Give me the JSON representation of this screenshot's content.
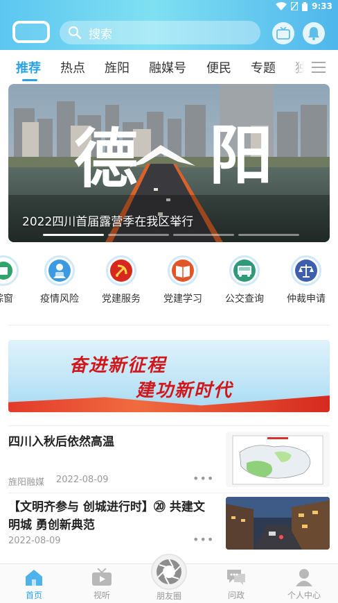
{
  "status_bar": {
    "time": "9:33"
  },
  "search": {
    "placeholder": "搜索"
  },
  "tabs": [
    {
      "label": "推荐",
      "active": true
    },
    {
      "label": "热点"
    },
    {
      "label": "旌阳"
    },
    {
      "label": "融媒号"
    },
    {
      "label": "便民"
    },
    {
      "label": "专题"
    },
    {
      "label": "独"
    }
  ],
  "banner": {
    "calligraphy": "德阳",
    "caption": "2022四川首届露营季在我区举行",
    "slide_count": 4,
    "active_slide": 1
  },
  "services": [
    {
      "label": "综窗",
      "icon": "window-icon",
      "color": "#2fa36b"
    },
    {
      "label": "疫情风险",
      "icon": "epidemic-icon",
      "color": "#3c9be0"
    },
    {
      "label": "党建服务",
      "icon": "party-emblem-icon",
      "color": "#d6281f"
    },
    {
      "label": "党建学习",
      "icon": "book-icon",
      "color": "#e0562a"
    },
    {
      "label": "公交查询",
      "icon": "bus-icon",
      "color": "#2f9a7a"
    },
    {
      "label": "仲裁申请",
      "icon": "scales-icon",
      "color": "#3d5fae"
    }
  ],
  "slogan": {
    "line1": "奋进新征程",
    "line2": "建功新时代"
  },
  "news": [
    {
      "title": "四川入秋后依然高温",
      "source": "旌阳融媒",
      "date": "2022-08-09",
      "thumb": "weather-map-thumbnail"
    },
    {
      "title": "【文明齐参与 创城进行时】⑳ 共建文明城 勇创新典范",
      "source": "",
      "date": "2022-08-09",
      "thumb": "city-street-thumbnail"
    }
  ],
  "more_label": "•••",
  "bottom_nav": [
    {
      "label": "首页",
      "icon": "home-icon",
      "active": true
    },
    {
      "label": "视听",
      "icon": "tv-icon"
    },
    {
      "label": "朋友圈",
      "icon": "camera-shutter-icon"
    },
    {
      "label": "问政",
      "icon": "chat-icon"
    },
    {
      "label": "个人中心",
      "icon": "user-icon"
    }
  ],
  "colors": {
    "accent": "#2aa3e6",
    "header_start": "#5cc6f0",
    "slogan_red": "#d0181c"
  }
}
